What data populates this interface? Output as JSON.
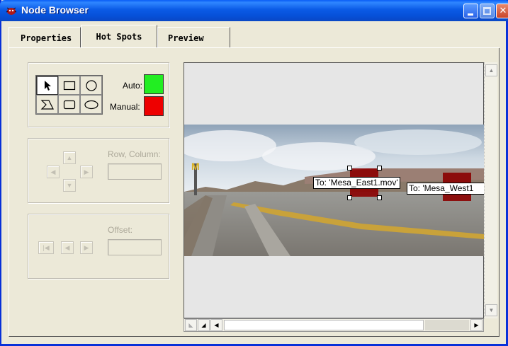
{
  "window": {
    "title": "Node Browser"
  },
  "tabs": [
    {
      "label": "Properties"
    },
    {
      "label": "Hot Spots"
    },
    {
      "label": "Preview"
    }
  ],
  "tools": {
    "labels": {
      "auto": "Auto:",
      "manual": "Manual:"
    },
    "colors": {
      "auto": "#22ee22",
      "manual": "#ee0000"
    }
  },
  "navigation": {
    "row_column_label": "Row, Column:",
    "row_column_value": "",
    "offset_label": "Offset:",
    "offset_value": ""
  },
  "preview": {
    "hotspots": [
      {
        "label": "To: 'Mesa_East1.mov'",
        "selected": true
      },
      {
        "label": "To: 'Mesa_West1",
        "selected": false
      }
    ]
  }
}
